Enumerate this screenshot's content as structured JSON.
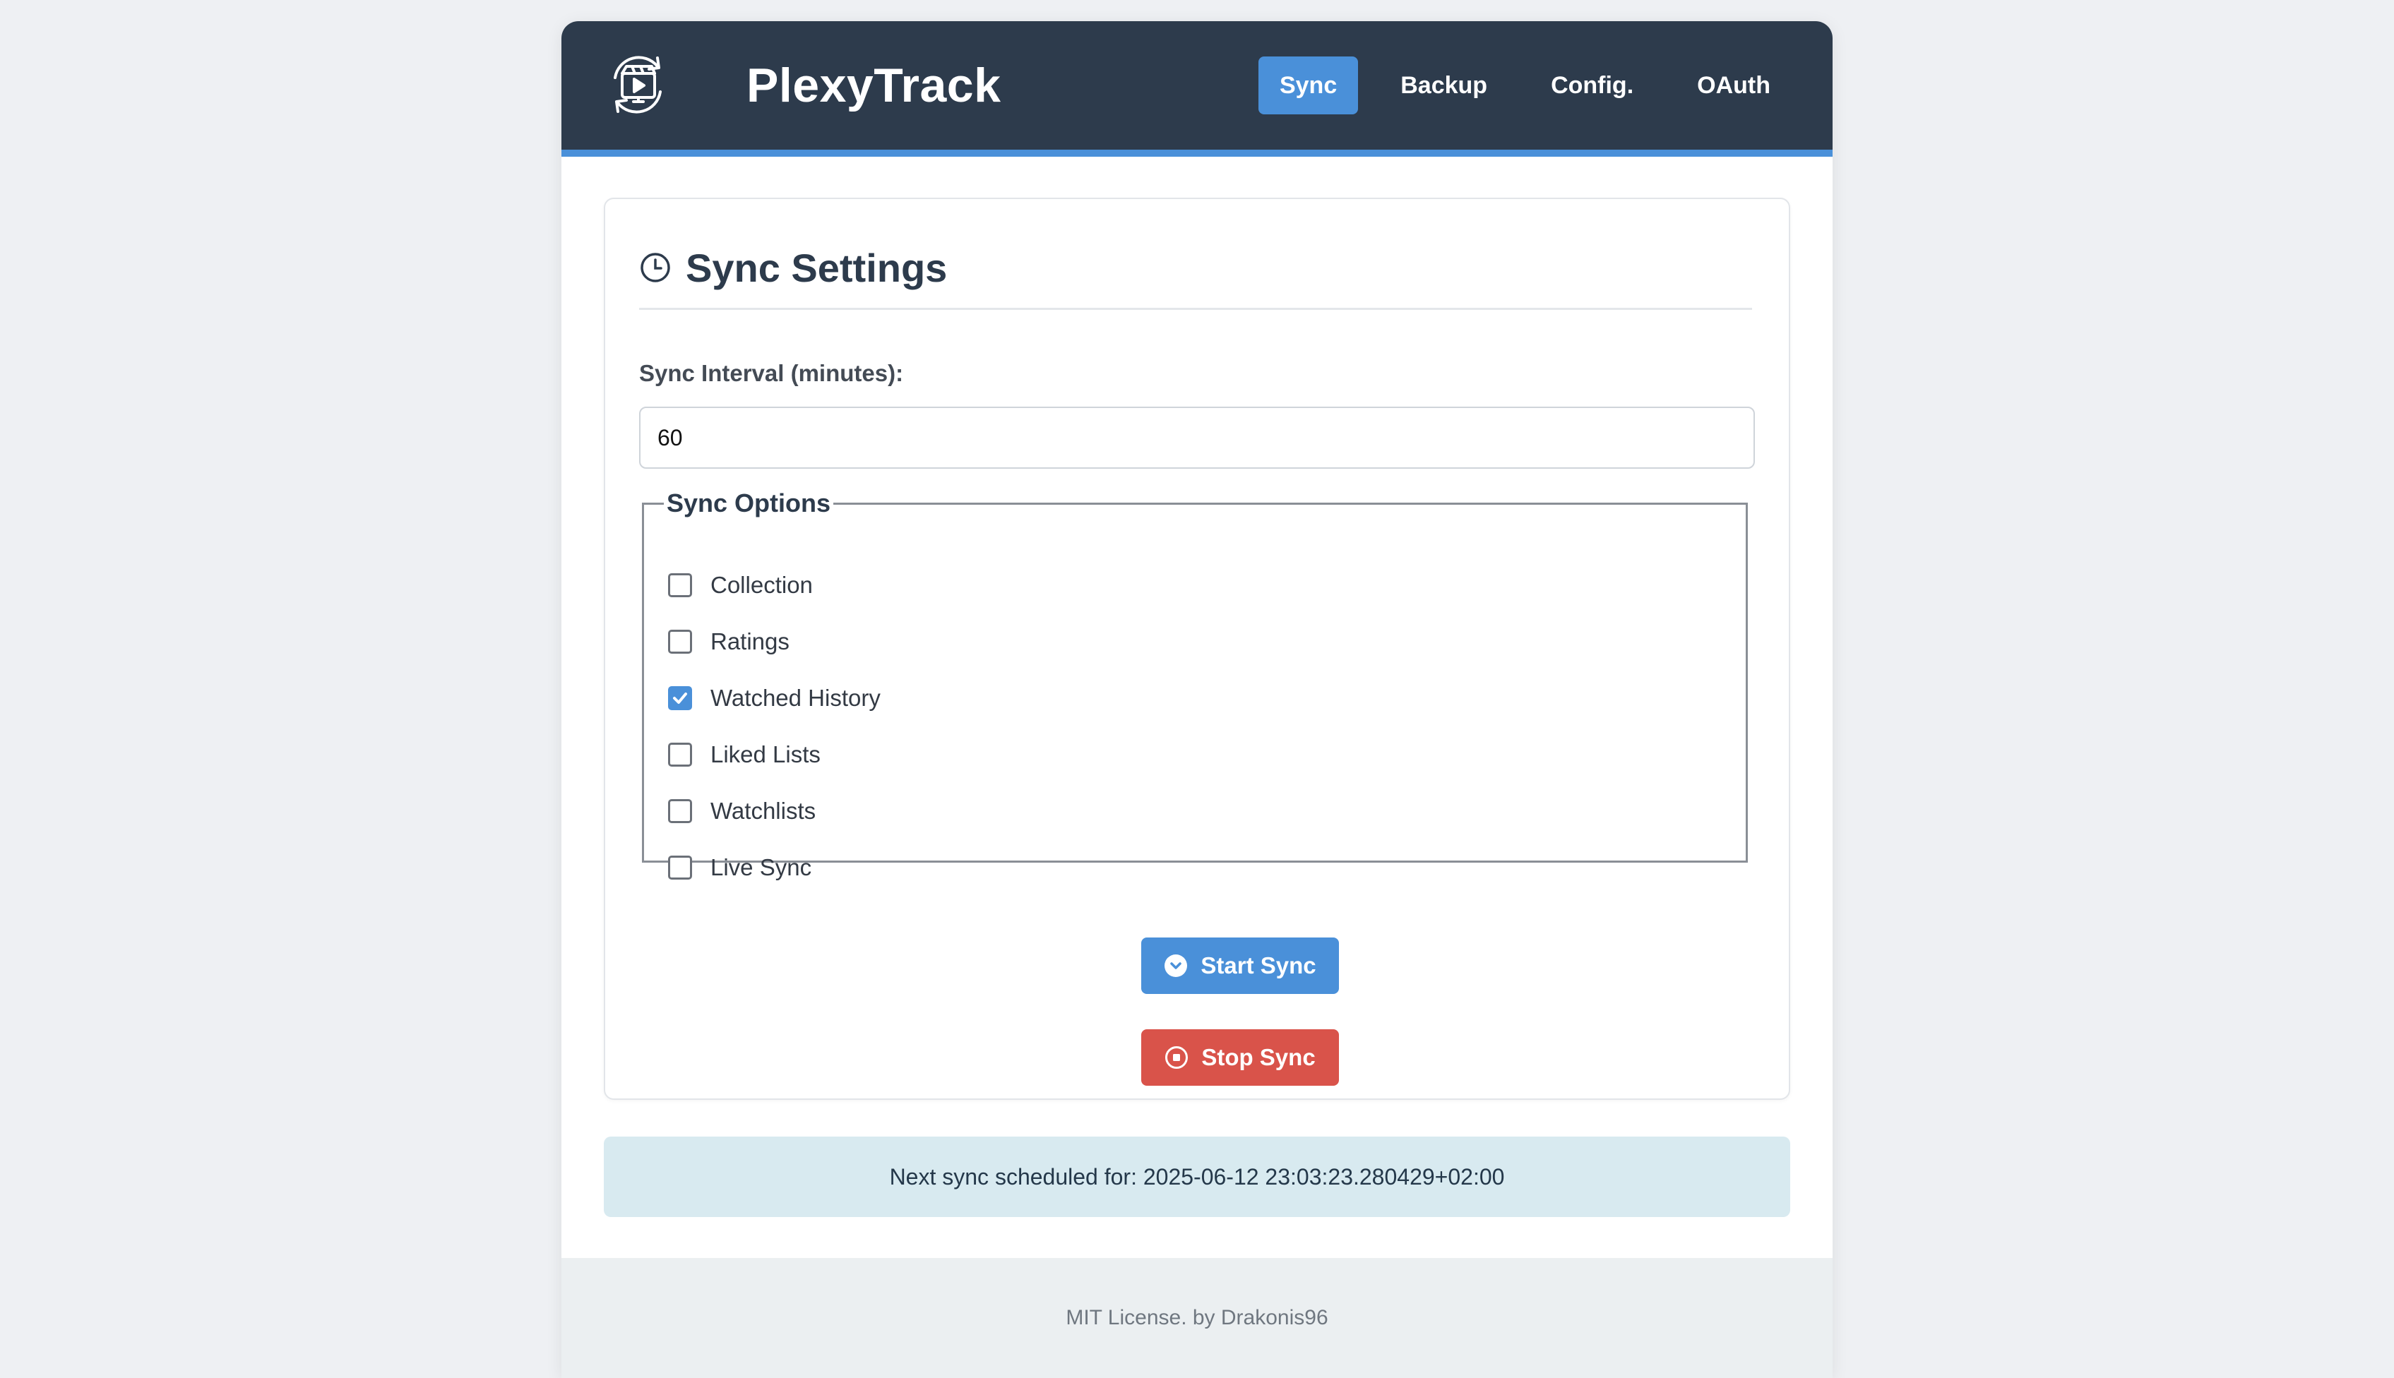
{
  "header": {
    "title": "PlexyTrack",
    "logo_icon": "sync-video-icon",
    "nav": [
      {
        "label": "Sync",
        "active": true
      },
      {
        "label": "Backup",
        "active": false
      },
      {
        "label": "Config.",
        "active": false
      },
      {
        "label": "OAuth",
        "active": false
      }
    ]
  },
  "settings": {
    "title": "Sync Settings",
    "title_icon": "clock-icon",
    "interval_label": "Sync Interval (minutes):",
    "interval_value": "60",
    "options_legend": "Sync Options",
    "options": [
      {
        "label": "Collection",
        "checked": false
      },
      {
        "label": "Ratings",
        "checked": false
      },
      {
        "label": "Watched History",
        "checked": true
      },
      {
        "label": "Liked Lists",
        "checked": false
      },
      {
        "label": "Watchlists",
        "checked": false
      },
      {
        "label": "Live Sync",
        "checked": false
      }
    ],
    "start_label": "Start Sync",
    "stop_label": "Stop Sync"
  },
  "notice": {
    "text": "Next sync scheduled for: 2025-06-12 23:03:23.280429+02:00"
  },
  "footer": {
    "text": "MIT License. by Drakonis96"
  },
  "colors": {
    "header_bg": "#2d3b4c",
    "accent": "#4a90d9",
    "danger": "#d9534a",
    "notice_bg": "#d8eaf0"
  }
}
